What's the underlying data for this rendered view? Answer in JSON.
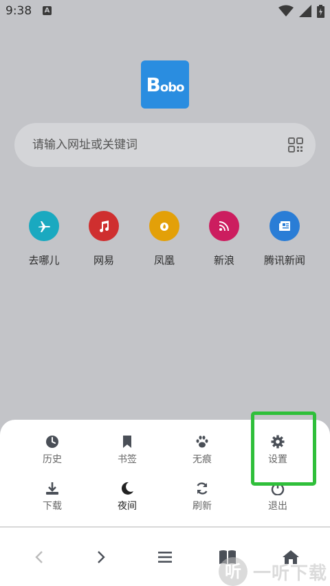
{
  "status_bar": {
    "time": "9:38",
    "notification_badge": "A"
  },
  "logo": {
    "text_big": "B",
    "text_small": "obo"
  },
  "search": {
    "placeholder": "请输入网址或关键词"
  },
  "shortcuts": [
    {
      "label": "去哪儿",
      "icon": "plane-icon",
      "color": "#1aa9c0"
    },
    {
      "label": "网易",
      "icon": "music-icon",
      "color": "#cf2f2f"
    },
    {
      "label": "凤凰",
      "icon": "fire-icon",
      "color": "#e3a008"
    },
    {
      "label": "新浪",
      "icon": "rss-icon",
      "color": "#cc1d5f"
    },
    {
      "label": "腾讯新闻",
      "icon": "newspaper-icon",
      "color": "#2a7dd6"
    }
  ],
  "menu": {
    "history": "历史",
    "bookmarks": "书签",
    "incognito": "无痕",
    "settings": "设置",
    "download": "下载",
    "night": "夜间",
    "refresh": "刷新",
    "exit": "退出"
  },
  "highlight_color": "#2fbf3a",
  "watermark": {
    "text": "一听下载",
    "glyph": "听"
  }
}
